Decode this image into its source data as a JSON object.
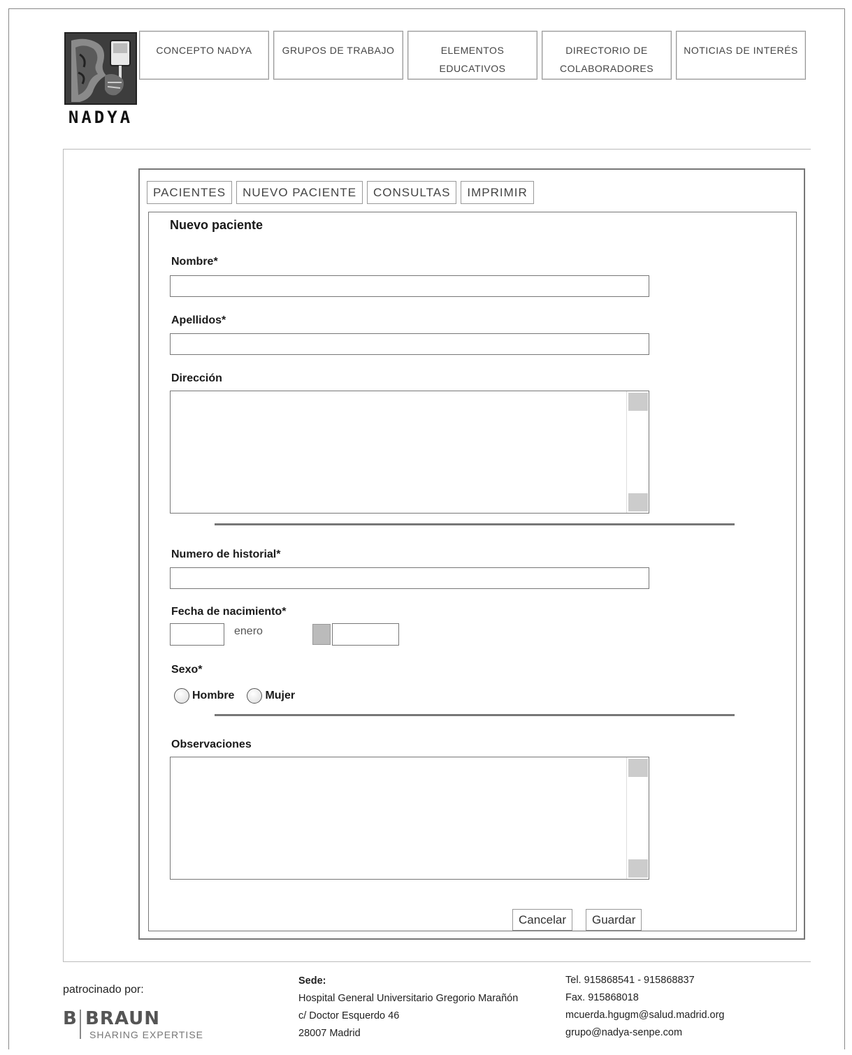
{
  "logo": {
    "text": "NADYA"
  },
  "topnav": [
    {
      "label": "CONCEPTO NADYA"
    },
    {
      "label": "GRUPOS DE TRABAJO"
    },
    {
      "label": "ELEMENTOS\nEDUCATIVOS"
    },
    {
      "label": "DIRECTORIO DE\nCOLABORADORES"
    },
    {
      "label": "NOTICIAS DE INTERÉS"
    }
  ],
  "tabs": [
    {
      "label": "PACIENTES"
    },
    {
      "label": "NUEVO PACIENTE"
    },
    {
      "label": "CONSULTAS"
    },
    {
      "label": "IMPRIMIR"
    }
  ],
  "form": {
    "title": "Nuevo paciente",
    "nombre_label": "Nombre*",
    "nombre_value": "",
    "apellidos_label": "Apellidos*",
    "apellidos_value": "",
    "direccion_label": "Dirección",
    "historial_label": "Numero de historial*",
    "historial_value": "",
    "fecha_label": "Fecha de nacimiento*",
    "month_selected": "enero",
    "sexo_label": "Sexo*",
    "sexo_options": [
      "Hombre",
      "Mujer"
    ],
    "observaciones_label": "Observaciones",
    "cancel_label": "Cancelar",
    "save_label": "Guardar"
  },
  "footer": {
    "sponsor_label": "patrocinado por:",
    "sponsor_logo_b": "B",
    "sponsor_logo_name": "BRAUN",
    "sponsor_tagline": "SHARING EXPERTISE",
    "sede_head": "Sede:",
    "sede_lines": [
      "Hospital General Universitario Gregorio Marañón",
      "c/ Doctor Esquerdo 46",
      "28007 Madrid"
    ],
    "contact_lines": [
      "Tel. 915868541 - 915868837",
      "Fax. 915868018",
      "mcuerda.hgugm@salud.madrid.org",
      "grupo@nadya-senpe.com"
    ]
  }
}
